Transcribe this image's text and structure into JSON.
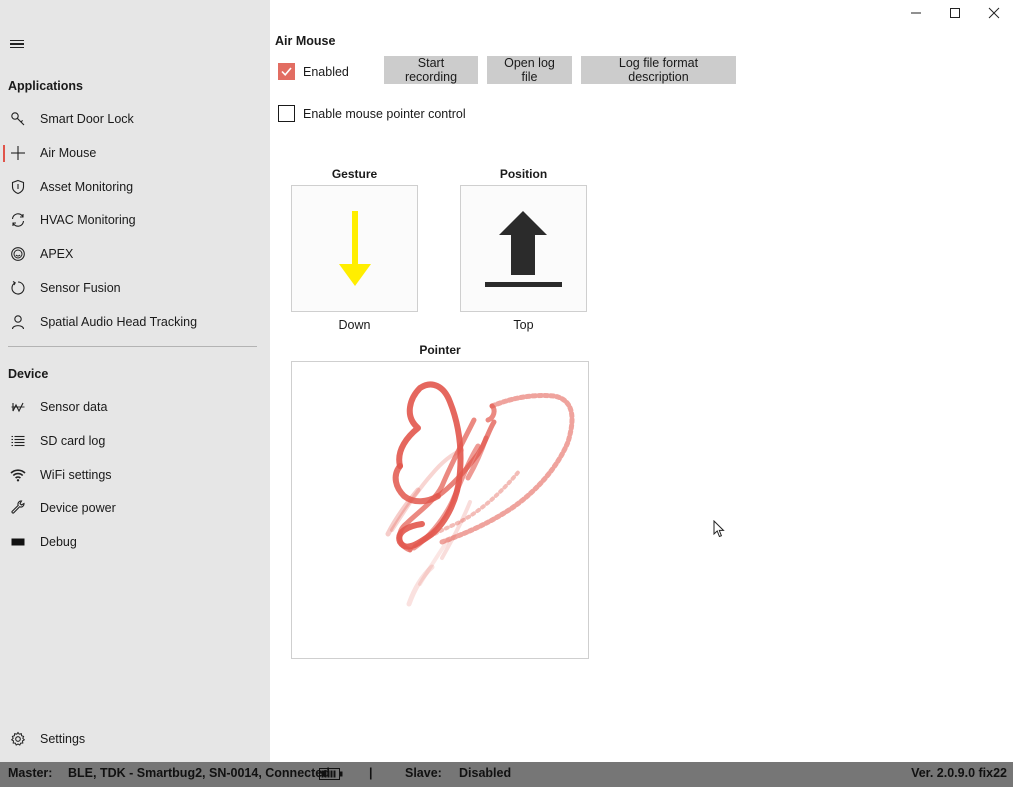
{
  "sidebar": {
    "applications_header": "Applications",
    "applications": [
      {
        "label": "Smart Door Lock",
        "icon": "key-icon"
      },
      {
        "label": "Air Mouse",
        "icon": "plus-icon",
        "selected": true
      },
      {
        "label": "Asset Monitoring",
        "icon": "shield-icon"
      },
      {
        "label": "HVAC Monitoring",
        "icon": "sync-icon"
      },
      {
        "label": "APEX",
        "icon": "smiley-icon"
      },
      {
        "label": "Sensor Fusion",
        "icon": "refresh-icon"
      },
      {
        "label": "Spatial Audio Head Tracking",
        "icon": "person-icon"
      }
    ],
    "device_header": "Device",
    "device": [
      {
        "label": "Sensor data",
        "icon": "sensor-icon"
      },
      {
        "label": "SD card log",
        "icon": "list-icon"
      },
      {
        "label": "WiFi settings",
        "icon": "wifi-icon"
      },
      {
        "label": "Device power",
        "icon": "wrench-icon"
      },
      {
        "label": "Debug",
        "icon": "debug-icon"
      }
    ],
    "settings": {
      "label": "Settings",
      "icon": "gear-icon"
    }
  },
  "main": {
    "title": "Air Mouse",
    "enabled_label": "Enabled",
    "enabled_checked": true,
    "buttons": {
      "start_recording": "Start recording",
      "open_log": "Open log file",
      "log_format": "Log file format description"
    },
    "pointer_control_label": "Enable mouse pointer control",
    "pointer_control_checked": false,
    "gesture": {
      "title": "Gesture",
      "value": "Down",
      "icon": "arrow-down-icon",
      "color": "#ffee00"
    },
    "position": {
      "title": "Position",
      "value": "Top",
      "icon": "arrow-up-bar-icon",
      "color": "#2b2b2b"
    },
    "pointer": {
      "title": "Pointer",
      "trail_color": "#e2574c"
    }
  },
  "statusbar": {
    "master_label": "Master:",
    "master_value": "BLE, TDK - Smartbug2, SN-0014, Connected",
    "separator": "|",
    "slave_label": "Slave:",
    "slave_value": "Disabled",
    "version": "Ver. 2.0.9.0 fix22"
  },
  "colors": {
    "accent": "#e0544a",
    "sidebar_bg": "#e6e6e6",
    "statusbar_bg": "#767676"
  }
}
